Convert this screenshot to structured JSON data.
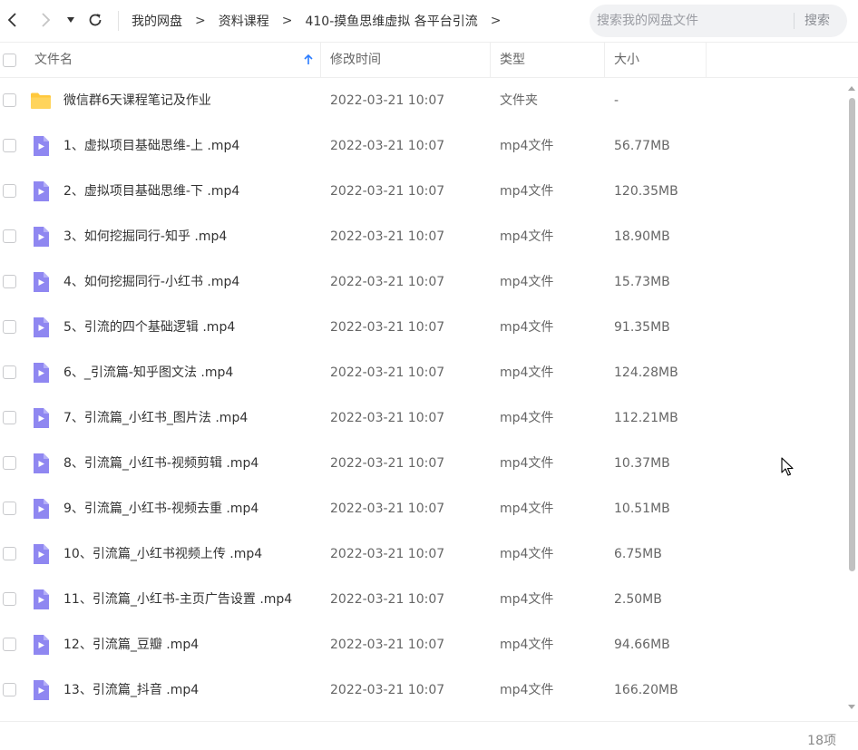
{
  "nav": {
    "back_icon": "chevron-left-icon",
    "forward_icon": "chevron-right-icon",
    "dropdown_icon": "caret-down-icon",
    "refresh_icon": "refresh-icon"
  },
  "breadcrumb": {
    "items": [
      "我的网盘",
      "资料课程",
      "410-摸鱼思维虚拟 各平台引流"
    ],
    "separator": ">"
  },
  "search": {
    "placeholder": "搜索我的网盘文件",
    "button_label": "搜索"
  },
  "table": {
    "columns": {
      "name": "文件名",
      "modified": "修改时间",
      "type": "类型",
      "size": "大小"
    },
    "sort_icon": "arrow-up-icon",
    "rows": [
      {
        "name": "微信群6天课程笔记及作业",
        "modified": "2022-03-21 10:07",
        "type": "文件夹",
        "size": "-",
        "icon": "folder-icon"
      },
      {
        "name": "1、虚拟项目基础思维-上 .mp4",
        "modified": "2022-03-21 10:07",
        "type": "mp4文件",
        "size": "56.77MB",
        "icon": "video-file-icon"
      },
      {
        "name": "2、虚拟项目基础思维-下 .mp4",
        "modified": "2022-03-21 10:07",
        "type": "mp4文件",
        "size": "120.35MB",
        "icon": "video-file-icon"
      },
      {
        "name": "3、如何挖掘同行-知乎 .mp4",
        "modified": "2022-03-21 10:07",
        "type": "mp4文件",
        "size": "18.90MB",
        "icon": "video-file-icon"
      },
      {
        "name": "4、如何挖掘同行-小红书 .mp4",
        "modified": "2022-03-21 10:07",
        "type": "mp4文件",
        "size": "15.73MB",
        "icon": "video-file-icon"
      },
      {
        "name": "5、引流的四个基础逻辑 .mp4",
        "modified": "2022-03-21 10:07",
        "type": "mp4文件",
        "size": "91.35MB",
        "icon": "video-file-icon"
      },
      {
        "name": "6、_引流篇-知乎图文法 .mp4",
        "modified": "2022-03-21 10:07",
        "type": "mp4文件",
        "size": "124.28MB",
        "icon": "video-file-icon"
      },
      {
        "name": "7、引流篇_小红书_图片法 .mp4",
        "modified": "2022-03-21 10:07",
        "type": "mp4文件",
        "size": "112.21MB",
        "icon": "video-file-icon"
      },
      {
        "name": "8、引流篇_小红书-视频剪辑 .mp4",
        "modified": "2022-03-21 10:07",
        "type": "mp4文件",
        "size": "10.37MB",
        "icon": "video-file-icon"
      },
      {
        "name": "9、引流篇_小红书-视频去重 .mp4",
        "modified": "2022-03-21 10:07",
        "type": "mp4文件",
        "size": "10.51MB",
        "icon": "video-file-icon"
      },
      {
        "name": "10、引流篇_小红书视频上传 .mp4",
        "modified": "2022-03-21 10:07",
        "type": "mp4文件",
        "size": "6.75MB",
        "icon": "video-file-icon"
      },
      {
        "name": "11、引流篇_小红书-主页广告设置 .mp4",
        "modified": "2022-03-21 10:07",
        "type": "mp4文件",
        "size": "2.50MB",
        "icon": "video-file-icon"
      },
      {
        "name": "12、引流篇_豆瓣 .mp4",
        "modified": "2022-03-21 10:07",
        "type": "mp4文件",
        "size": "94.66MB",
        "icon": "video-file-icon"
      },
      {
        "name": "13、引流篇_抖音 .mp4",
        "modified": "2022-03-21 10:07",
        "type": "mp4文件",
        "size": "166.20MB",
        "icon": "video-file-icon"
      }
    ]
  },
  "footer": {
    "item_count": "18项"
  },
  "colors": {
    "folder": "#ffc83d",
    "video_file": "#8f87f1",
    "sort_arrow": "#2b7cff",
    "search_bg": "#f1f2f4"
  }
}
